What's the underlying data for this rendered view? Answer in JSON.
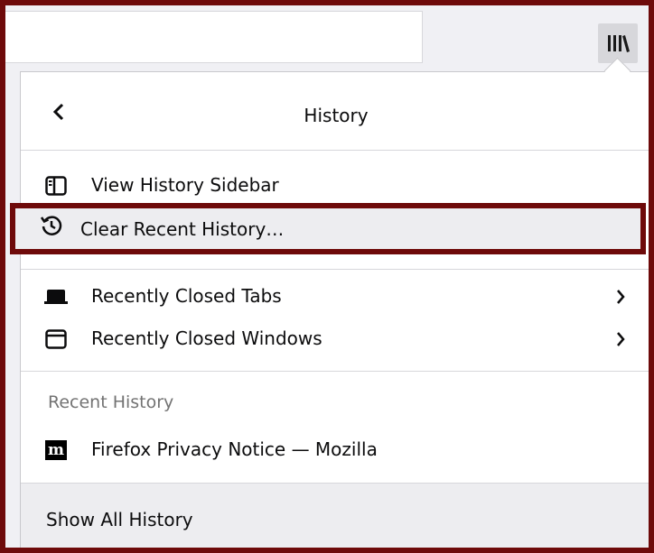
{
  "panel": {
    "title": "History",
    "items": [
      {
        "label": "View History Sidebar",
        "icon": "sidebar-icon"
      },
      {
        "label": "Clear Recent History…",
        "icon": "history-clock-icon"
      },
      {
        "label": "Recently Closed Tabs",
        "icon": "tab-icon"
      },
      {
        "label": "Recently Closed Windows",
        "icon": "window-icon"
      }
    ],
    "recent_label": "Recent History",
    "recent_items": [
      {
        "label": "Firefox Privacy Notice — Mozilla",
        "favicon_text": "m",
        "icon": "mozilla-favicon-icon"
      }
    ],
    "footer_label": "Show All History"
  },
  "colors": {
    "highlight_border": "#6e0a0a",
    "toolbar_bg": "#f0f0f4",
    "hover_bg": "#ededf0"
  }
}
